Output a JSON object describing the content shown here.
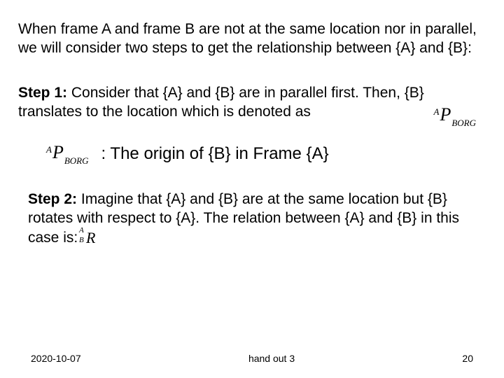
{
  "intro": "When frame A and frame B are not at the same location nor in parallel, we will consider two steps to get the relationship between {A} and {B}:",
  "step1": {
    "label": "Step 1:",
    "text": "Consider that {A} and {B} are in parallel first. Then, {B} translates to the location which is denoted as"
  },
  "pborg": {
    "pre": "A",
    "main": "P",
    "sub": "BORG"
  },
  "defn": ": The origin of {B} in Frame {A}",
  "step2": {
    "label": "Step 2:",
    "text": "Imagine that {A} and {B} are at the same location but {B} rotates with respect to {A}. The relation between {A} and {B} in this case is:"
  },
  "rot": {
    "preTop": "A",
    "preBot": "B",
    "main": "R"
  },
  "footer": {
    "date": "2020-10-07",
    "handout": "hand out 3",
    "page": "20"
  }
}
